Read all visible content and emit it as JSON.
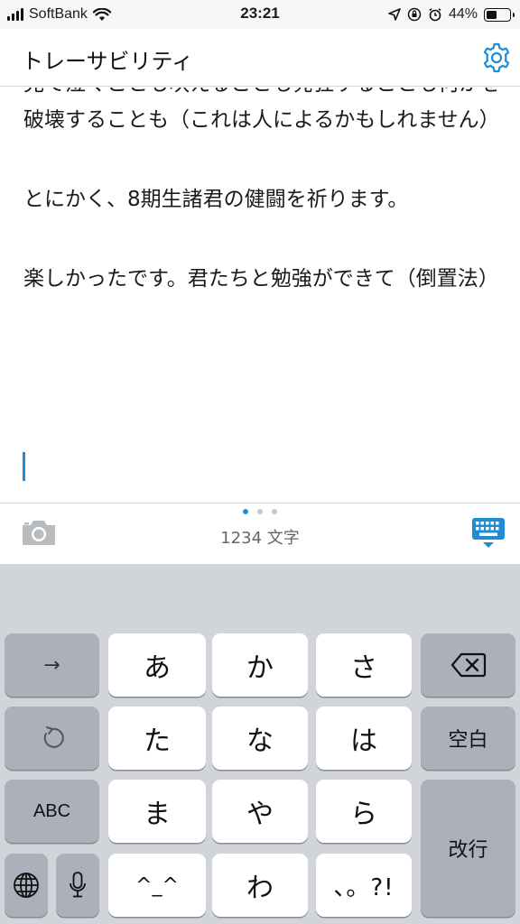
{
  "status_bar": {
    "carrier": "SoftBank",
    "time": "23:21",
    "battery_percent": "44%",
    "battery_level": 0.44
  },
  "header": {
    "title": "トレーサビリティ",
    "settings_icon": "gear-icon",
    "accent_color": "#1f8dd6"
  },
  "content": {
    "paragraphs": [
      "見て泣くことも吠えることも発狂することも何かを破壊することも（これは人によるかもしれません）",
      "とにかく、8期生諸君の健闘を祈ります。",
      "楽しかったです。君たちと勉強ができて（倒置法）"
    ]
  },
  "toolbar": {
    "char_count": "1234 文字",
    "camera_icon": "camera-icon",
    "keyboard_icon": "keyboard-hide-icon",
    "page_count": 3,
    "active_page": 1
  },
  "keyboard": {
    "row1": {
      "next": "→",
      "a": "あ",
      "ka": "か",
      "sa": "さ",
      "delete_icon": "backspace-icon"
    },
    "row2": {
      "undo_icon": "undo-icon",
      "ta": "た",
      "na": "な",
      "ha": "は",
      "space": "空白"
    },
    "row3": {
      "abc": "ABC",
      "ma": "ま",
      "ya": "や",
      "ra": "ら",
      "return": "改行"
    },
    "row4": {
      "globe_icon": "globe-icon",
      "mic_icon": "microphone-icon",
      "face": "^_^",
      "wa": "わ",
      "punct": "、。?!"
    }
  }
}
